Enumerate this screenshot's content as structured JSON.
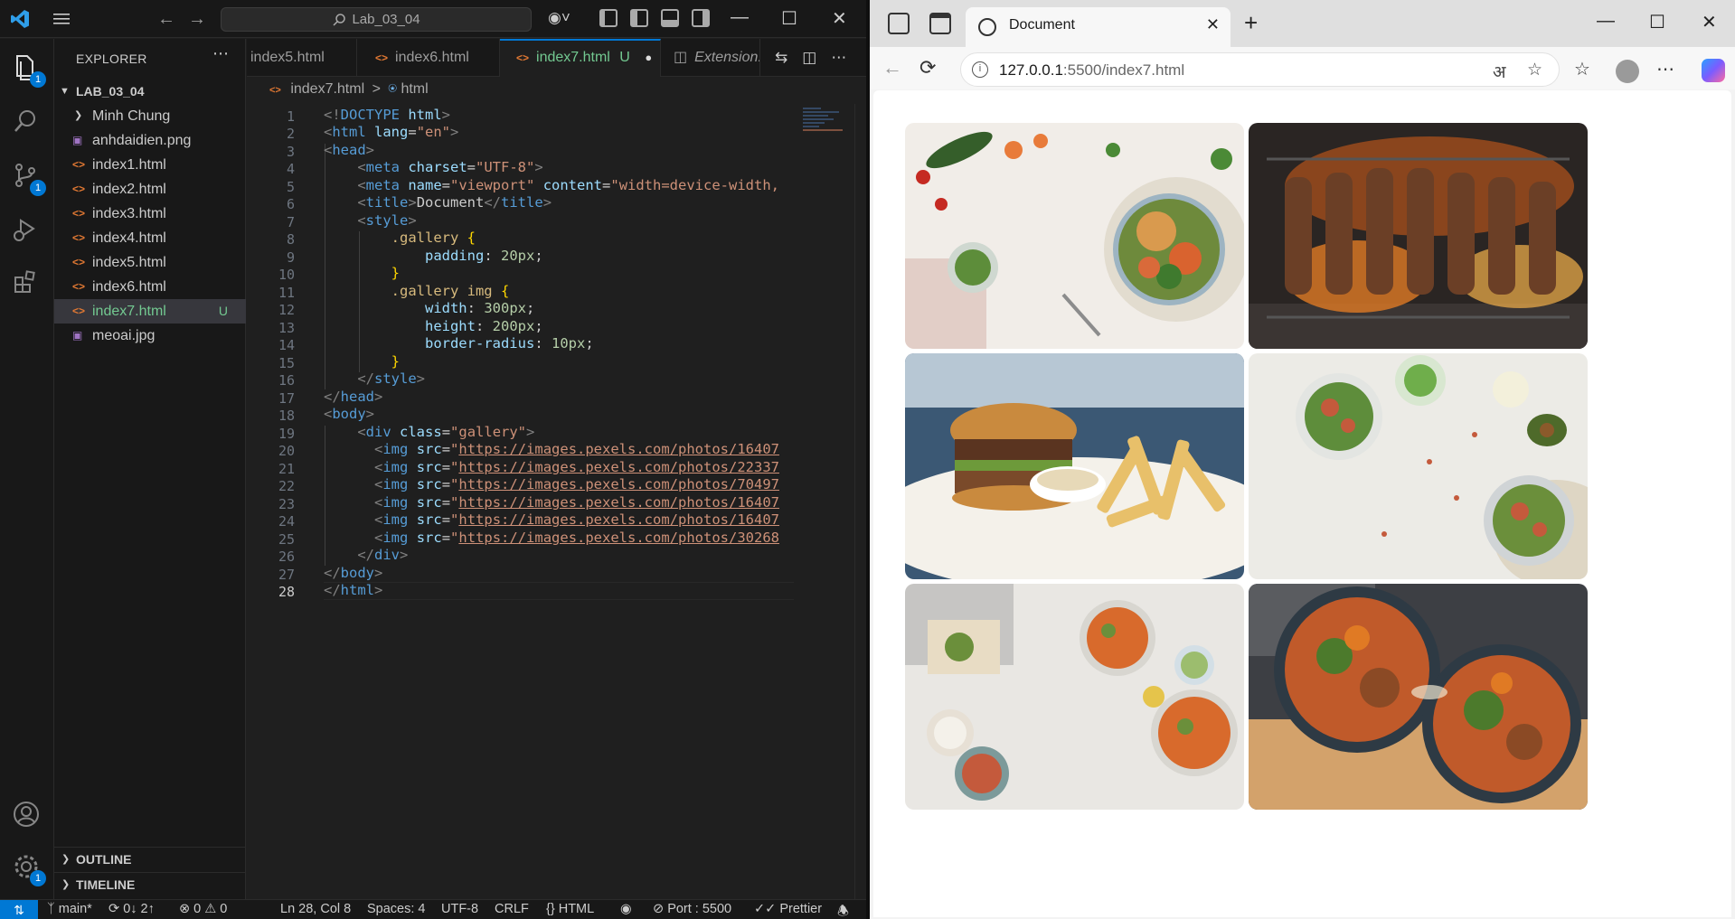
{
  "vscode": {
    "search": "Lab_03_04",
    "badges": {
      "explorer": "1",
      "source_control": "1",
      "settings": "1"
    },
    "explorer": {
      "header": "EXPLORER",
      "folder": "LAB_03_04",
      "items": [
        {
          "name": "Minh Chung",
          "type": "folder"
        },
        {
          "name": "anhdaidien.png",
          "type": "image"
        },
        {
          "name": "index1.html",
          "type": "html"
        },
        {
          "name": "index2.html",
          "type": "html"
        },
        {
          "name": "index3.html",
          "type": "html"
        },
        {
          "name": "index4.html",
          "type": "html"
        },
        {
          "name": "index5.html",
          "type": "html"
        },
        {
          "name": "index6.html",
          "type": "html"
        },
        {
          "name": "index7.html",
          "type": "html",
          "status": "U",
          "active": true
        },
        {
          "name": "meoai.jpg",
          "type": "image"
        }
      ],
      "outline": "OUTLINE",
      "timeline": "TIMELINE"
    },
    "tabs": [
      {
        "label": "index5.html"
      },
      {
        "label": "index6.html"
      },
      {
        "label": "index7.html",
        "status": "U",
        "active": true
      },
      {
        "label": "Extension: "
      }
    ],
    "breadcrumb": {
      "file": "index7.html",
      "sep": ">",
      "node": "html"
    },
    "cursor_line": "28",
    "status": {
      "branch": "main*",
      "sync": "0↓ 2↑",
      "problems": "⊗ 0 ⚠ 0",
      "position": "Ln 28, Col 8",
      "spaces": "Spaces: 4",
      "encoding": "UTF-8",
      "eol": "CRLF",
      "language": "HTML",
      "port": "Port : 5500",
      "formatter": "Prettier"
    }
  },
  "browser": {
    "tab_title": "Document",
    "url_host": "127.0.0.1",
    "url_rest": ":5500/index7.html",
    "images": [
      {
        "alt": "salad-plate-photo",
        "palette": [
          "#f1ede8",
          "#d96a3a",
          "#3f7a2e",
          "#a84a30"
        ]
      },
      {
        "alt": "grilled-skewers-photo",
        "palette": [
          "#2a2523",
          "#e07a24",
          "#6b3f26",
          "#f4b04a"
        ]
      },
      {
        "alt": "burger-fries-photo",
        "palette": [
          "#3b5874",
          "#e8c06a",
          "#8b5a2b",
          "#f4f1ea"
        ]
      },
      {
        "alt": "salad-bowls-photo",
        "palette": [
          "#ecebe6",
          "#c45a3c",
          "#5e8d3b",
          "#d8cdb5"
        ]
      },
      {
        "alt": "sweet-potato-bowls-photo",
        "palette": [
          "#e9e7e3",
          "#d86a2c",
          "#6b8f3b",
          "#a3a3a3"
        ]
      },
      {
        "alt": "noodle-bowls-photo",
        "palette": [
          "#3d3f44",
          "#c05a2a",
          "#4c7a2c",
          "#d3a26b"
        ]
      }
    ]
  }
}
